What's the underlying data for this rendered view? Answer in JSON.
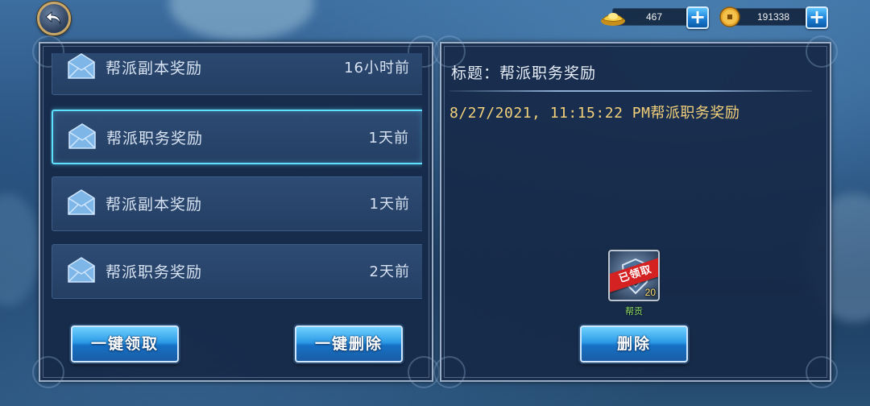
{
  "currency": {
    "gold": {
      "icon": "gold-ingot-icon",
      "value": "467",
      "plus": "+"
    },
    "coin": {
      "icon": "copper-coin-icon",
      "value": "191338",
      "plus": "+"
    }
  },
  "mail": {
    "items": [
      {
        "title": "帮派副本奖励",
        "time": "16小时前",
        "selected": false
      },
      {
        "title": "帮派职务奖励",
        "time": "1天前",
        "selected": true
      },
      {
        "title": "帮派副本奖励",
        "time": "1天前",
        "selected": false
      },
      {
        "title": "帮派职务奖励",
        "time": "2天前",
        "selected": false
      }
    ],
    "claim_all_label": "一键领取",
    "delete_all_label": "一键删除"
  },
  "detail": {
    "title": "标题：帮派职务奖励",
    "body": "8/27/2021, 11:15:22 PM帮派职务奖励",
    "reward": {
      "icon": "guild-contribution-emblem-icon",
      "status": "已领取",
      "count": "20",
      "name": "帮贡"
    },
    "delete_label": "删除"
  },
  "colors": {
    "accent_selected": "#5fe0ff",
    "body_text": "#f3d07a",
    "reward_name": "#8fe36b",
    "ribbon": "#d42222"
  }
}
